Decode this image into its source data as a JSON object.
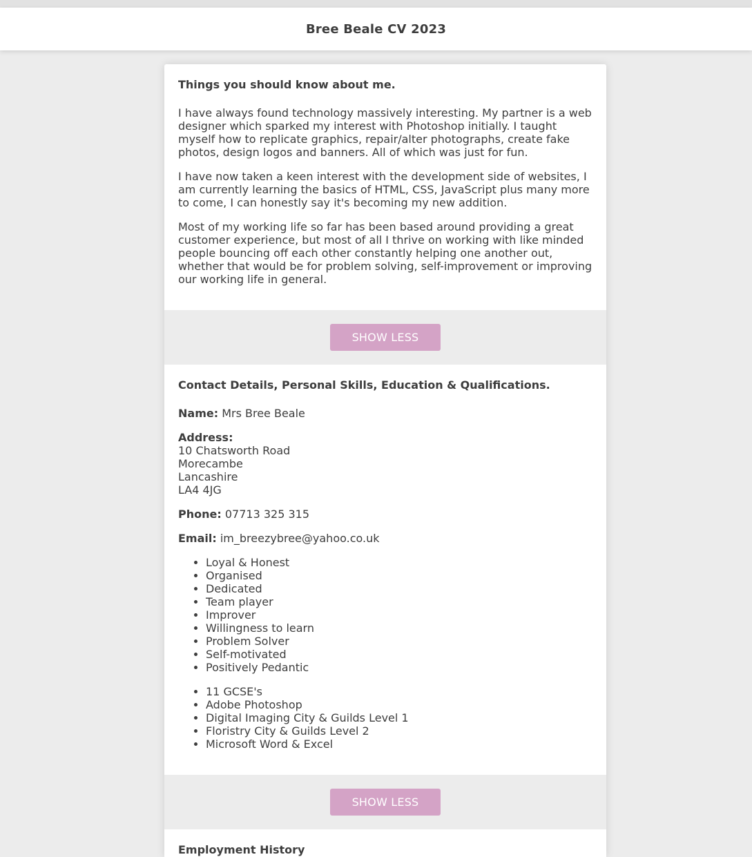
{
  "header": {
    "title": "Bree Beale CV 2023"
  },
  "about": {
    "heading": "Things you should know about me.",
    "paragraphs": [
      "I have always found technology massively interesting. My partner is a web designer which sparked my interest with Photoshop initially. I taught myself how to replicate graphics, repair/alter photographs, create fake photos, design logos and banners. All of which was just for fun.",
      "I have now taken a keen interest with the development side of websites, I am currently learning the basics of HTML, CSS, JavaScript plus many more to come, I can honestly say it's becoming my new addition.",
      "Most of my working life so far has been based around providing a great customer experience, but most of all I thrive on working with like minded people bouncing off each other constantly helping one another out, whether that would be for problem solving, self-improvement or improving our working life in general."
    ],
    "toggle_label": "SHOW LESS"
  },
  "contact": {
    "heading": "Contact Details, Personal Skills, Education & Qualifications.",
    "name_label": "Name:",
    "name_value": "Mrs Bree Beale",
    "address_label": "Address:",
    "address_lines": [
      "10 Chatsworth Road",
      "Morecambe",
      "Lancashire",
      "LA4 4JG"
    ],
    "phone_label": "Phone:",
    "phone_value": "07713 325 315",
    "email_label": "Email:",
    "email_value": "im_breezybree@yahoo.co.uk",
    "skills": [
      "Loyal & Honest",
      "Organised",
      "Dedicated",
      "Team player",
      "Improver",
      "Willingness to learn",
      "Problem Solver",
      "Self-motivated",
      "Positively Pedantic"
    ],
    "qualifications": [
      "11 GCSE's",
      "Adobe Photoshop",
      "Digital Imaging City & Guilds Level 1",
      "Floristry City & Guilds Level 2",
      "Microsoft Word & Excel"
    ],
    "toggle_label": "SHOW LESS"
  },
  "employment": {
    "heading": "Employment History"
  }
}
